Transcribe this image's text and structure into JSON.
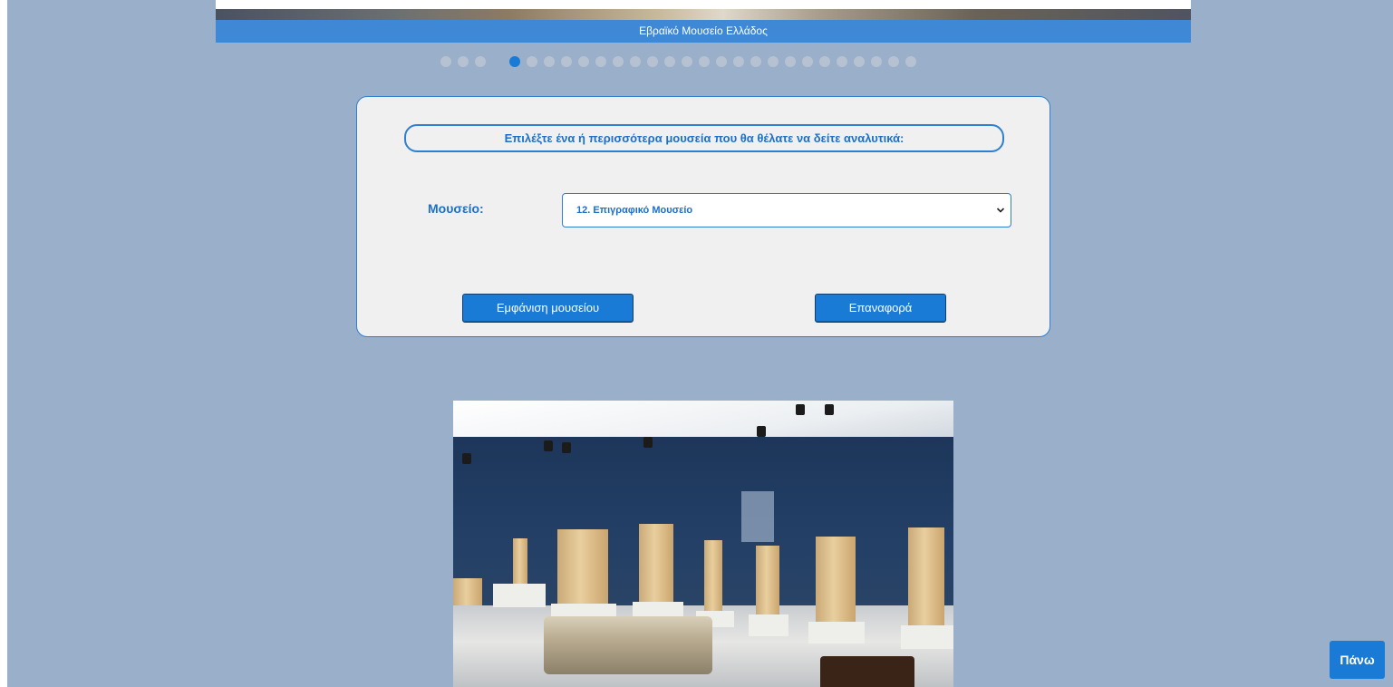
{
  "slideshow": {
    "caption": "Εβραϊκό Μουσείο Ελλάδος",
    "dot_count": 28,
    "active_dot_index": 4
  },
  "form": {
    "heading": "Επιλέξτε ένα ή περισσότερα μουσεία που θα θέλατε να δείτε αναλυτικά:",
    "museum_label": "Μουσείο:",
    "museum_select_value": "12. Επιγραφικό Μουσείο",
    "show_button_label": "Εμφάνιση μουσείου",
    "reset_button_label": "Επαναφορά"
  },
  "back_to_top_label": "Πάνω",
  "colors": {
    "page_background": "#9aafc9",
    "accent_blue": "#1a7bd6",
    "caption_bar": "#3f88d6",
    "panel_background": "#f0f0f0"
  },
  "icons": {
    "select_arrow": "chevron-down-icon"
  }
}
